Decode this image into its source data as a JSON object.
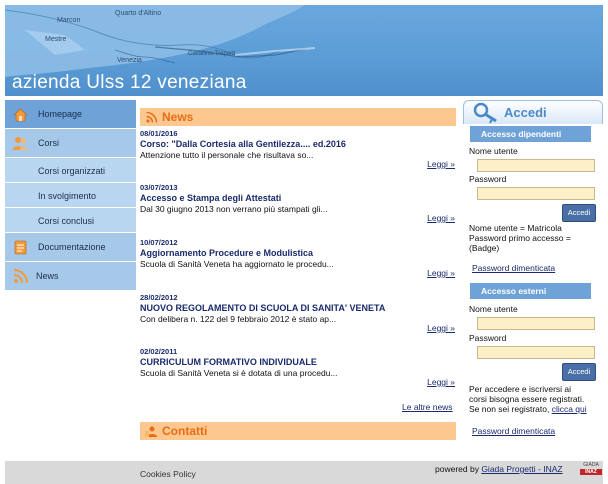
{
  "header": {
    "site_title": "azienda Ulss 12 veneziana",
    "map_places": [
      "Quarto d'Altino",
      "Marcon",
      "Mestre",
      "Venezia",
      "Cavallino-Treporti"
    ]
  },
  "nav": {
    "items": [
      {
        "label": "Homepage",
        "icon": "home-icon"
      },
      {
        "label": "Corsi",
        "icon": "people-icon"
      },
      {
        "label": "Corsi organizzati"
      },
      {
        "label": "In svolgimento"
      },
      {
        "label": "Corsi conclusi"
      },
      {
        "label": "Documentazione",
        "icon": "document-icon"
      },
      {
        "label": "News",
        "icon": "rss-icon"
      }
    ]
  },
  "news": {
    "heading": "News",
    "items": [
      {
        "date": "08/01/2016",
        "title": "Corso: \"Dalla Cortesia alla Gentilezza.... ed.2016",
        "text": "Attenzione tutto il personale che risultava so...",
        "more": "Leggi »"
      },
      {
        "date": "03/07/2013",
        "title": "Accesso e Stampa degli Attestati",
        "text": "Dal 30 giugno 2013 non verrano più stampati gli...",
        "more": "Leggi »"
      },
      {
        "date": "10/07/2012",
        "title": "Aggiornamento Procedure e Modulistica",
        "text": "Scuola di Sanità Veneta ha aggiornato le procedu...",
        "more": "Leggi »"
      },
      {
        "date": "28/02/2012",
        "title": "NUOVO REGOLAMENTO DI SCUOLA DI SANITA' VENETA",
        "text": "Con delibera n. 122 del 9 febbraio 2012 è stato ap...",
        "more": "Leggi »"
      },
      {
        "date": "02/02/2011",
        "title": "CURRICULUM FORMATIVO INDIVIDUALE",
        "text": "Scuola di Sanità Veneta si è dotata di una procedu...",
        "more": "Leggi »"
      }
    ],
    "all_news": "Le altre news"
  },
  "contatti": {
    "heading": "Contatti"
  },
  "login": {
    "heading": "Accedi",
    "dipendenti": {
      "heading": "Accesso dipendenti",
      "user_label": "Nome utente",
      "pass_label": "Password",
      "button": "Accedi",
      "note1": "Nome utente = Matricola",
      "note2": "Password primo accesso =",
      "note3": "(Badge)",
      "forgot": "Password dimenticata"
    },
    "esterni": {
      "heading": "Accesso esterni",
      "user_label": "Nome utente",
      "pass_label": "Password",
      "button": "Accedi",
      "note1": "Per accedere e iscriversi ai",
      "note2": "corsi bisogna essere registrati.",
      "note3": "Se non sei  registrato, ",
      "note3_link": "clicca qui",
      "forgot": "Password dimenticata"
    }
  },
  "footer": {
    "cookies": "Cookies Policy",
    "powered_prefix": "powered by ",
    "powered_link": "Giada Progetti - INAZ",
    "logo_text_top": "GIADA",
    "logo_text_bottom": "INAZ"
  },
  "colors": {
    "header_blue": "#5b9cd6",
    "nav_blue": "#a6c9ea",
    "nav_active": "#6fa3d8",
    "section_orange": "#fdc890",
    "section_text": "#e66e15",
    "input_bg": "#fdf0c6",
    "link_blue": "#1a2a6c"
  }
}
